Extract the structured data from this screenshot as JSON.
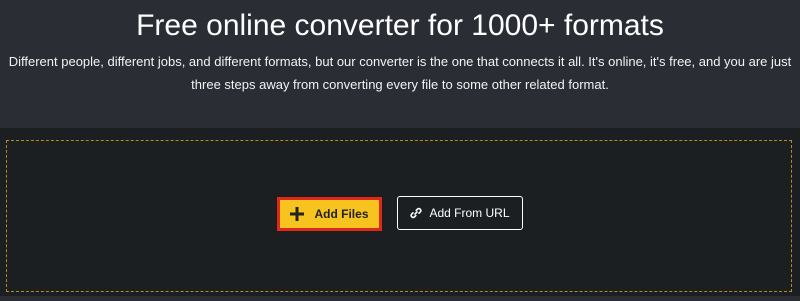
{
  "hero": {
    "title": "Free online converter for 1000+ formats",
    "description_line1": "Different people, different jobs, and different formats, but our converter is the one that connects it all. It's online, it's free, and you are just",
    "description_line2": "three steps away from converting every file to some other related format."
  },
  "upload": {
    "add_files_label": "Add Files",
    "add_url_label": "Add From URL",
    "add_files_icon": "plus-icon",
    "add_url_icon": "link-icon"
  },
  "colors": {
    "background": "#24272c",
    "dropzone_border": "#b58b1e",
    "primary_button": "#f7c31e",
    "primary_button_outline": "#e0271c"
  }
}
